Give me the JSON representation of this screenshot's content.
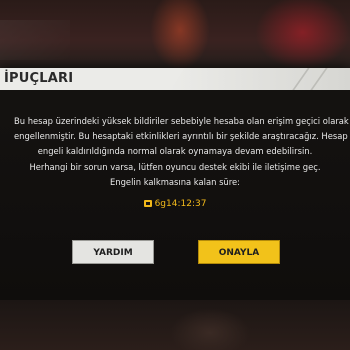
{
  "dialog": {
    "title": "İPUÇLARI",
    "message_lines": [
      "Bu hesap üzerindeki yüksek bildiriler sebebiyle hesaba olan erişim geçici olarak",
      "engellenmiştir. Bu hesaptaki etkinlikleri ayrıntılı bir şekilde araştıracağız. Hesap",
      "engeli kaldırıldığında normal olarak oynamaya devam edebilirsin.",
      "Herhangi bir sorun varsa, lütfen oyuncu destek ekibi ile iletişime geç.",
      "Engelin kalkmasına kalan süre:"
    ],
    "timer_value": "6g14:12:37",
    "timer_icon": "clock-icon",
    "buttons": {
      "help_label": "YARDIM",
      "confirm_label": "ONAYLA"
    }
  },
  "colors": {
    "accent": "#f2c21a",
    "timer": "#f2b91a",
    "title_bar": "#ebebe8",
    "dialog_bg": "#151311"
  }
}
